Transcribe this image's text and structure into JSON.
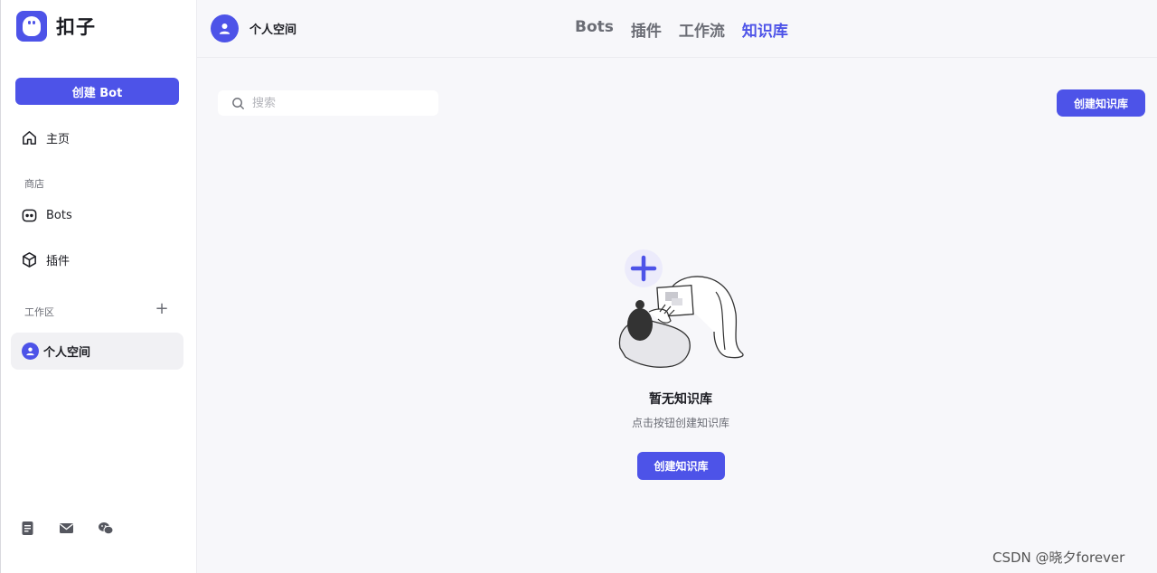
{
  "brand": {
    "name": "扣子"
  },
  "sidebar": {
    "create_bot_label": "创建 Bot",
    "home_label": "主页",
    "store_section_label": "商店",
    "store_items": [
      {
        "label": "Bots",
        "icon": "bot-face-icon"
      },
      {
        "label": "插件",
        "icon": "cube-icon"
      }
    ],
    "workspace_section_label": "工作区",
    "workspace_active": "个人空间",
    "bottom_icons": [
      "document-icon",
      "mail-icon",
      "wechat-icon"
    ]
  },
  "header": {
    "space_title": "个人空间",
    "tabs": [
      "Bots",
      "插件",
      "工作流",
      "知识库"
    ],
    "active_tab": "知识库"
  },
  "main": {
    "search_placeholder": "搜索",
    "create_knowledge_label": "创建知识库",
    "empty_title": "暂无知识库",
    "empty_subtitle": "点击按钮创建知识库",
    "empty_create_label": "创建知识库"
  },
  "watermark": "CSDN @晓夕forever",
  "colors": {
    "accent": "#4d53e8"
  }
}
